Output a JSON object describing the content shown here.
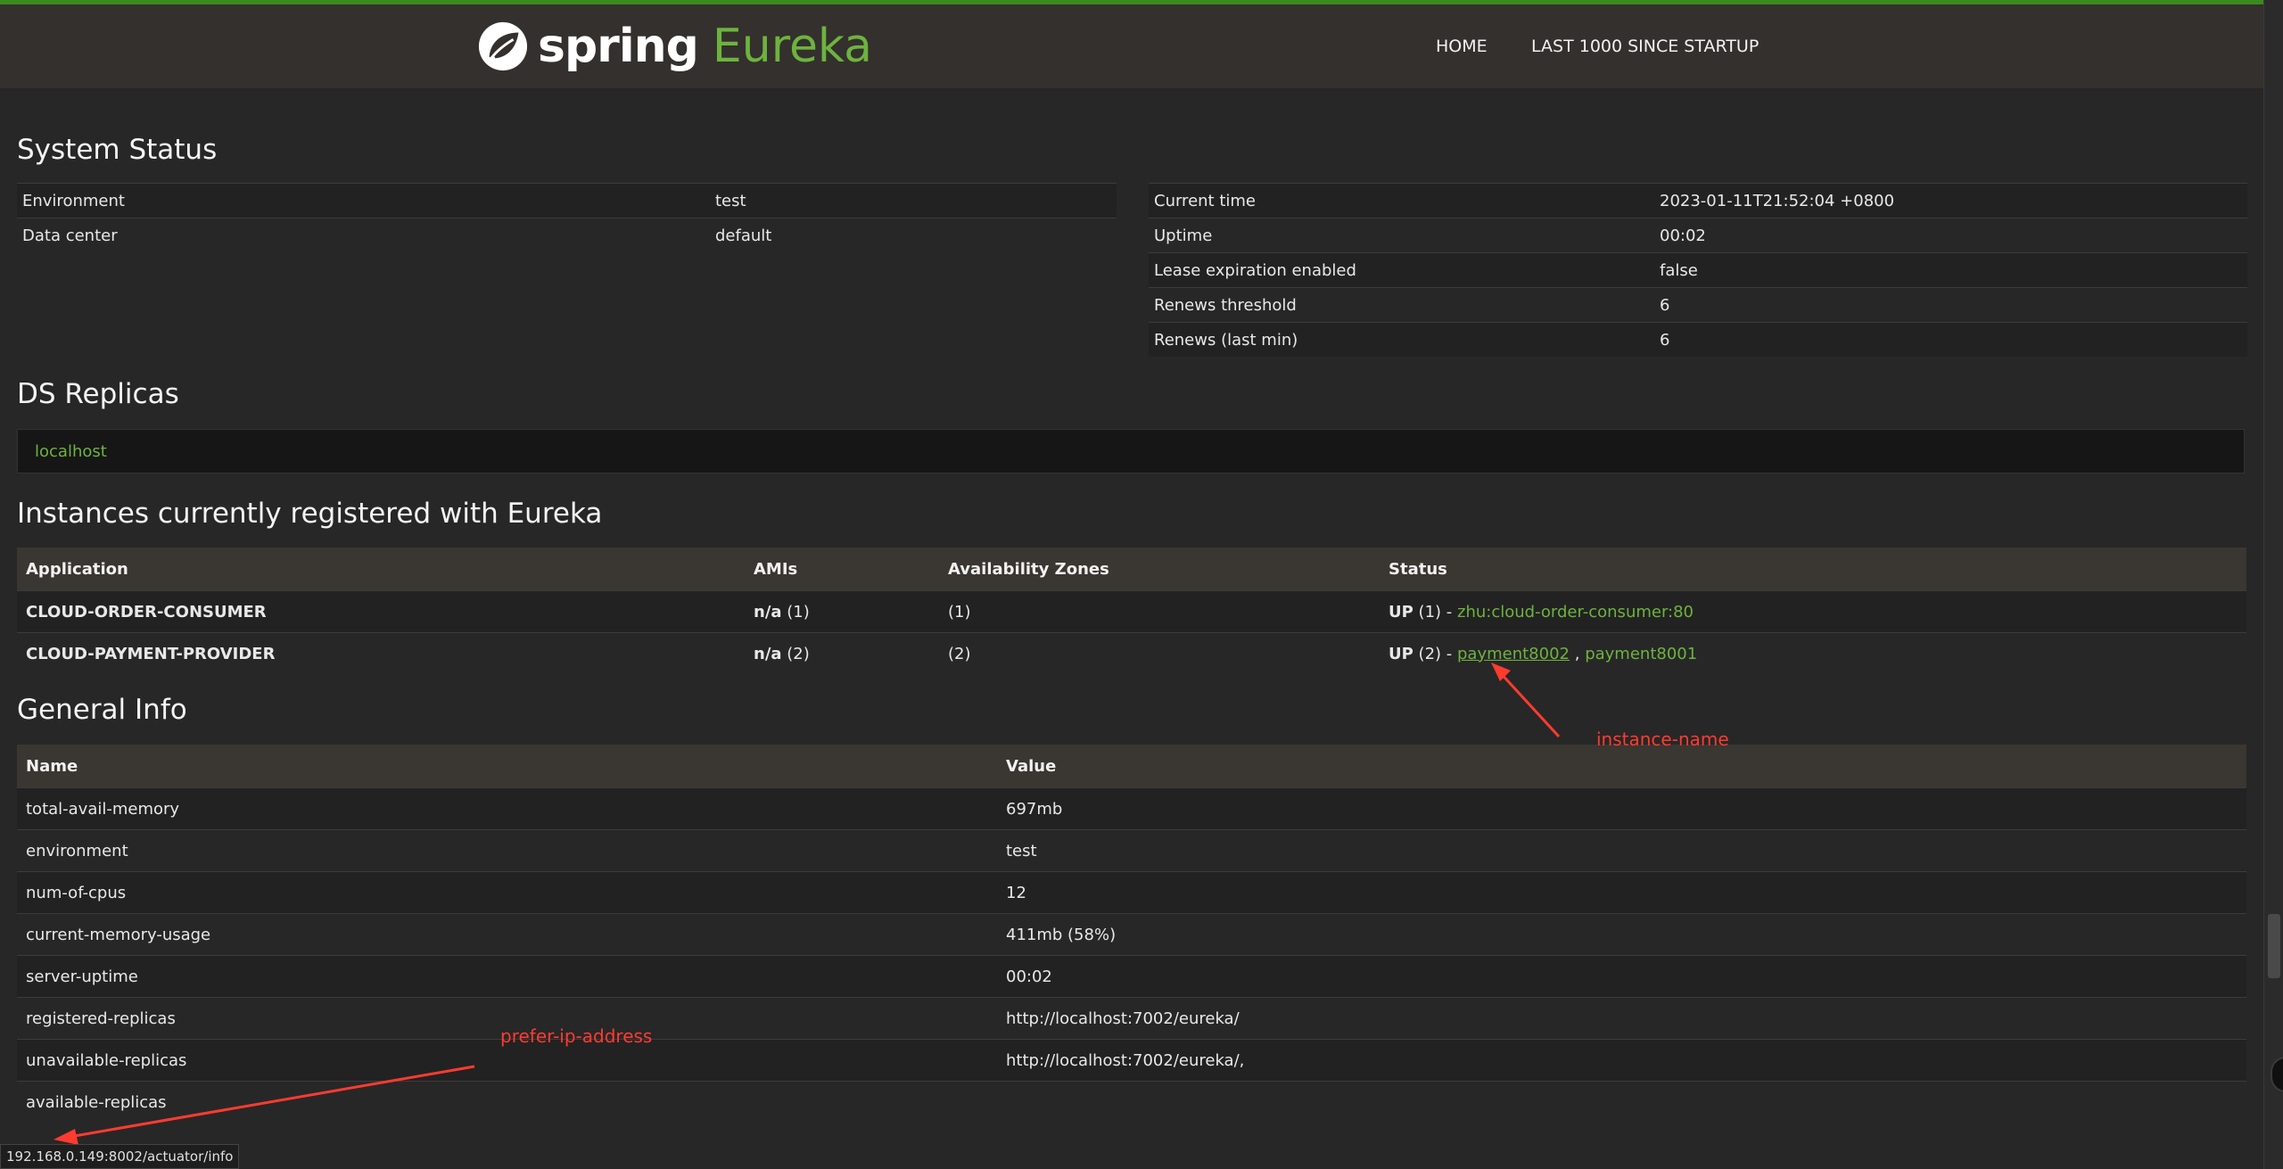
{
  "header": {
    "brand_spring": "spring",
    "brand_eureka": "Eureka",
    "nav": [
      "HOME",
      "LAST 1000 SINCE STARTUP"
    ]
  },
  "system_status": {
    "title": "System Status",
    "left": [
      {
        "label": "Environment",
        "value": "test"
      },
      {
        "label": "Data center",
        "value": "default"
      }
    ],
    "right": [
      {
        "label": "Current time",
        "value": "2023-01-11T21:52:04 +0800"
      },
      {
        "label": "Uptime",
        "value": "00:02"
      },
      {
        "label": "Lease expiration enabled",
        "value": "false"
      },
      {
        "label": "Renews threshold",
        "value": "6"
      },
      {
        "label": "Renews (last min)",
        "value": "6"
      }
    ]
  },
  "ds_replicas": {
    "title": "DS Replicas",
    "item": "localhost"
  },
  "instances": {
    "title": "Instances currently registered with Eureka",
    "columns": [
      "Application",
      "AMIs",
      "Availability Zones",
      "Status"
    ],
    "rows": [
      {
        "app": "CLOUD-ORDER-CONSUMER",
        "ami_label": "n/a",
        "ami_count": "(1)",
        "zones": "(1)",
        "status": "UP",
        "status_count": "(1) -",
        "links": [
          "zhu:cloud-order-consumer:80"
        ]
      },
      {
        "app": "CLOUD-PAYMENT-PROVIDER",
        "ami_label": "n/a",
        "ami_count": "(2)",
        "zones": "(2)",
        "status": "UP",
        "status_count": "(2) -",
        "links": [
          "payment8002",
          "payment8001"
        ],
        "separator": ","
      }
    ]
  },
  "general_info": {
    "title": "General Info",
    "columns": [
      "Name",
      "Value"
    ],
    "rows": [
      {
        "name": "total-avail-memory",
        "value": "697mb"
      },
      {
        "name": "environment",
        "value": "test"
      },
      {
        "name": "num-of-cpus",
        "value": "12"
      },
      {
        "name": "current-memory-usage",
        "value": "411mb (58%)"
      },
      {
        "name": "server-uptime",
        "value": "00:02"
      },
      {
        "name": "registered-replicas",
        "value": "http://localhost:7002/eureka/"
      },
      {
        "name": "unavailable-replicas",
        "value": "http://localhost:7002/eureka/,"
      },
      {
        "name": "available-replicas",
        "value": ""
      }
    ]
  },
  "annotations": {
    "instance_name": "instance-name",
    "prefer_ip": "prefer-ip-address",
    "color": "#ff3b30"
  },
  "browser": {
    "status_url": "192.168.0.149:8002/actuator/info"
  },
  "colors": {
    "accent_green": "#6db33f",
    "navbar": "#34302d",
    "background": "#272727"
  }
}
